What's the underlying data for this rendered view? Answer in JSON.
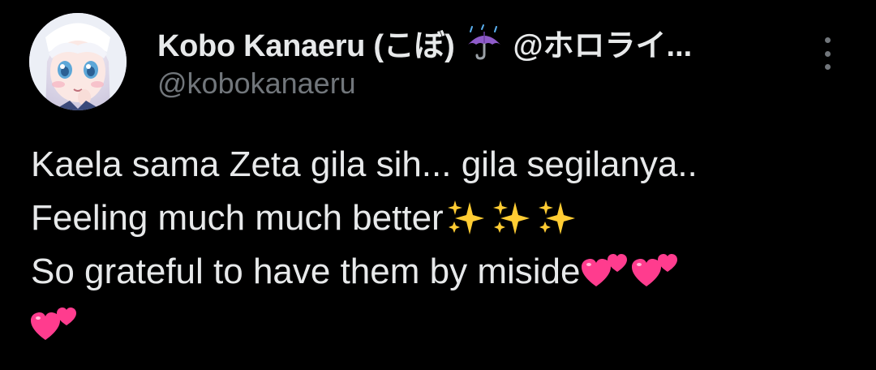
{
  "tweet": {
    "author": {
      "display_name": "Kobo Kanaeru (こぼ)",
      "name_suffix": "@ホロライ...",
      "handle": "@kobokanaeru",
      "avatar_icon": "avatar-image",
      "badge_icon": "umbrella-rain-icon"
    },
    "more_icon": "more-vertical-icon",
    "text_lines": [
      "Kaela sama Zeta gila sih... gila segilanya..",
      "Feeling much much better",
      "So grateful to have them by miside"
    ],
    "emojis": {
      "sparkles": "sparkles-icon",
      "hearts": "two-hearts-icon"
    },
    "colors": {
      "background": "#000000",
      "text_primary": "#e7e9ea",
      "text_secondary": "#71767b",
      "heart_pink": "#ff3c8e",
      "sparkle_gold": "#ffcc33"
    }
  }
}
